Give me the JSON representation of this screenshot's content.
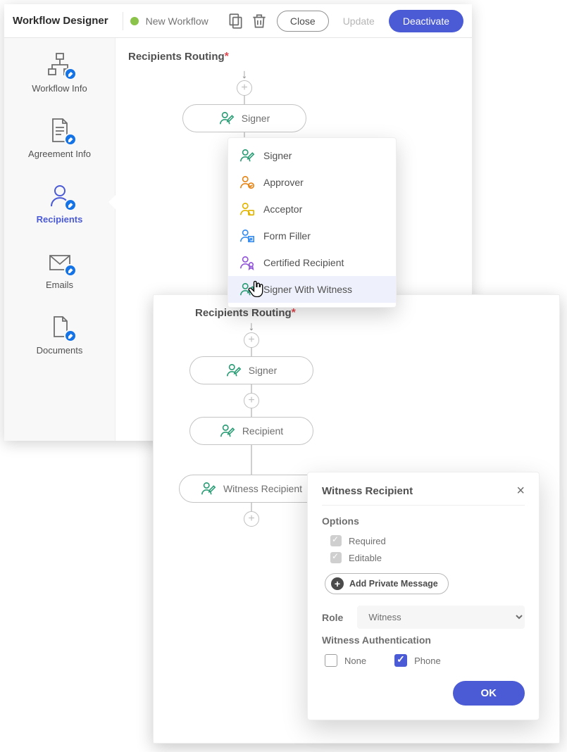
{
  "header": {
    "title": "Workflow Designer",
    "status": "New Workflow",
    "close": "Close",
    "update": "Update",
    "deactivate": "Deactivate"
  },
  "sidebar": {
    "items": [
      {
        "label": "Workflow Info"
      },
      {
        "label": "Agreement Info"
      },
      {
        "label": "Recipients"
      },
      {
        "label": "Emails"
      },
      {
        "label": "Documents"
      }
    ]
  },
  "routing": {
    "title": "Recipients Routing",
    "nodes1": [
      {
        "label": "Signer"
      }
    ],
    "nodes2": [
      {
        "label": "Signer"
      },
      {
        "label": "Recipient"
      },
      {
        "label": "Witness Recipient"
      }
    ]
  },
  "dropdown": {
    "items": [
      {
        "label": "Signer",
        "color": "#2d9d78"
      },
      {
        "label": "Approver",
        "color": "#e68619"
      },
      {
        "label": "Acceptor",
        "color": "#e2b500"
      },
      {
        "label": "Form Filler",
        "color": "#378ef0"
      },
      {
        "label": "Certified Recipient",
        "color": "#9256d9"
      },
      {
        "label": "Signer With Witness",
        "color": "#2d9d78"
      }
    ]
  },
  "props": {
    "title": "Witness Recipient",
    "options_label": "Options",
    "required": "Required",
    "editable": "Editable",
    "add_private": "Add Private Message",
    "role_label": "Role",
    "role_value": "Witness",
    "auth_label": "Witness Authentication",
    "auth_none": "None",
    "auth_phone": "Phone",
    "ok": "OK"
  }
}
